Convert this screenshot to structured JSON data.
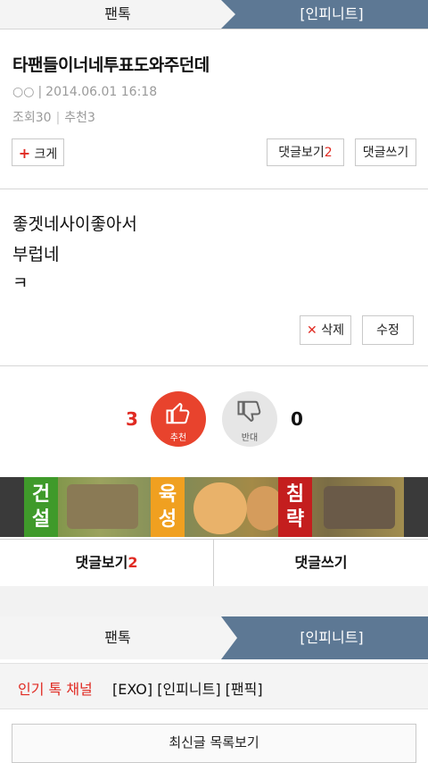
{
  "breadcrumb_top": {
    "left": "팬톡",
    "right": "[인피니트]"
  },
  "post": {
    "title": "타팬들이너네투표도와주던데",
    "author": "○○",
    "separator": "|",
    "datetime": "2014.06.01 16:18",
    "views_label": "조회30",
    "stat_sep": "|",
    "recommend_label": "추천3"
  },
  "toolbar": {
    "enlarge_icon": "+",
    "enlarge_label": "크게",
    "view_comments_label": "댓글보기",
    "comment_count": "2",
    "write_comment_label": "댓글쓰기"
  },
  "content": {
    "lines": [
      "좋겟네사이좋아서",
      "부럽네",
      "ㅋ"
    ]
  },
  "actions": {
    "delete_icon": "✕",
    "delete_label": "삭제",
    "edit_label": "수정"
  },
  "vote": {
    "up_count": "3",
    "up_label": "추천",
    "down_label": "반대",
    "down_count": "0",
    "up_icon": "thumbs-up-icon",
    "down_icon": "thumbs-down-icon"
  },
  "banner": {
    "tags": [
      "건설",
      "육성",
      "침략"
    ]
  },
  "comment_bar": {
    "view_label": "댓글보기",
    "count": "2",
    "write_label": "댓글쓰기"
  },
  "breadcrumb_bottom": {
    "left": "팬톡",
    "right": "[인피니트]"
  },
  "channel": {
    "label": "인기 톡 채널",
    "items": "[EXO] [인피니트] [팬픽]"
  },
  "list_button": "최신글 목록보기",
  "colors": {
    "accent": "#e02a22",
    "nav_blue": "#5d7894"
  }
}
